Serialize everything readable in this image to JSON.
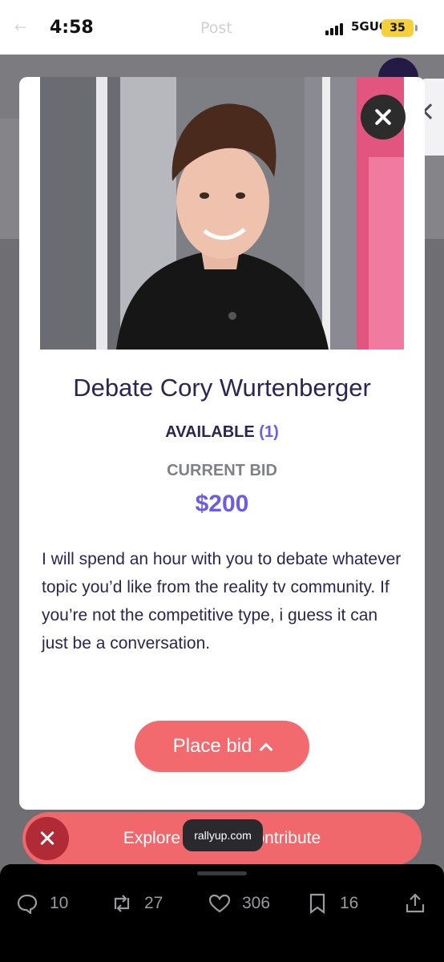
{
  "status_bar": {
    "time": "4:58",
    "center_title": "Post",
    "network": "5GUC",
    "battery": "35"
  },
  "auction_item": {
    "title": "Debate Cory Wurtenberger",
    "available_label": "AVAILABLE",
    "available_count": "(1)",
    "current_bid_label": "CURRENT BID",
    "current_bid_value": "$200",
    "description": "I will spend an hour with you to debate whatever topic you’d like from the reality tv community. If you’re not the competitive type, i guess it can just be a conversation.",
    "place_bid_label": "Place bid"
  },
  "explore_bar": {
    "text": "Explore ways to contribute",
    "url_badge": "rallyup.com"
  },
  "post_actions": {
    "replies": "10",
    "reposts": "27",
    "likes": "306",
    "bookmarks": "16"
  },
  "colors": {
    "accent_purple": "#6c5ce7",
    "button_coral": "#f26a6d",
    "title_navy": "#2b2650"
  }
}
